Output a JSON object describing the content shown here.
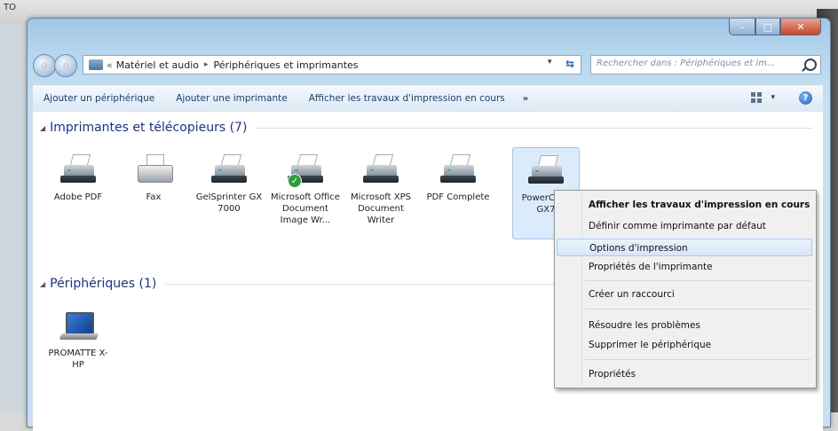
{
  "desktop": {
    "corner_label": "TO"
  },
  "window": {
    "caption_buttons": {
      "minimize": "–",
      "maximize": "□",
      "close": "✕"
    }
  },
  "nav": {
    "back_icon": "arrow-left-icon",
    "forward_icon": "arrow-right-icon"
  },
  "address": {
    "chevron": "«",
    "segments": [
      "Matériel et audio",
      "Périphériques et imprimantes"
    ],
    "separator": "▸",
    "dropdown": "▾",
    "refresh": "⇆"
  },
  "search": {
    "placeholder": "Rechercher dans : Périphériques et im..."
  },
  "toolbar": {
    "items": [
      "Ajouter un périphérique",
      "Ajouter une imprimante",
      "Afficher les travaux d'impression en cours"
    ],
    "more": "»",
    "view_dropdown": "▾",
    "help": "?"
  },
  "groups": [
    {
      "title": "Imprimantes et télécopieurs (7)",
      "items": [
        {
          "label": "Adobe PDF",
          "icon": "printer-icon"
        },
        {
          "label": "Fax",
          "icon": "fax-icon"
        },
        {
          "label": "GelSprinter GX 7000",
          "icon": "printer-icon"
        },
        {
          "label": "Microsoft Office Document Image Wr...",
          "icon": "printer-icon",
          "default": true
        },
        {
          "label": "Microsoft XPS Document Writer",
          "icon": "printer-icon"
        },
        {
          "label": "PDF Complete",
          "icon": "printer-icon"
        },
        {
          "label": "PowerC r R GX7",
          "icon": "printer-icon",
          "selected": true
        }
      ]
    },
    {
      "title": "Périphériques (1)",
      "items": [
        {
          "label": "PROMATTE X-HP",
          "icon": "laptop-icon"
        }
      ]
    }
  ],
  "context_menu": {
    "items": [
      "Afficher les travaux d'impression en cours",
      "Définir comme imprimante par défaut",
      "Options d'impression",
      "Propriétés de l'imprimante",
      "Créer un raccourci",
      "Résoudre les problèmes",
      "Supprimer le périphérique",
      "Propriétés"
    ]
  }
}
